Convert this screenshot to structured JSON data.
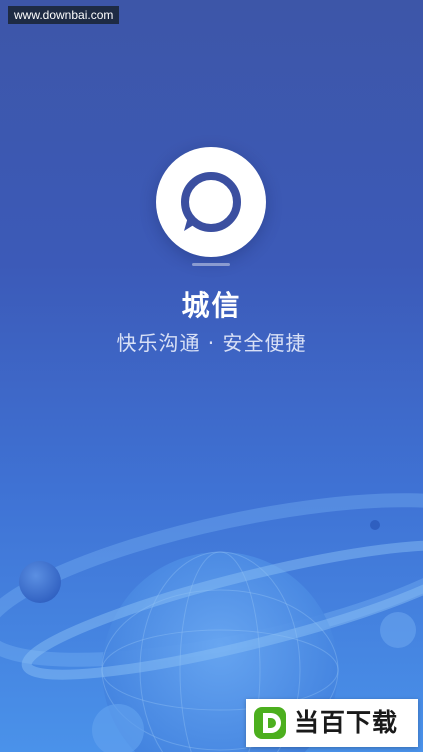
{
  "watermark": {
    "text": "www.downbai.com"
  },
  "app": {
    "name": "城信",
    "slogan": "快乐沟通 · 安全便捷",
    "icon": "chat-bubble-icon"
  },
  "badge": {
    "text": "当百下载",
    "icon": "d-logo-icon"
  },
  "colors": {
    "bg_top": "#3d56a8",
    "bg_bottom": "#4a92ea",
    "logo_fill": "#ffffff",
    "logo_ring": "#3b4fa0",
    "badge_green": "#4caf1e"
  }
}
